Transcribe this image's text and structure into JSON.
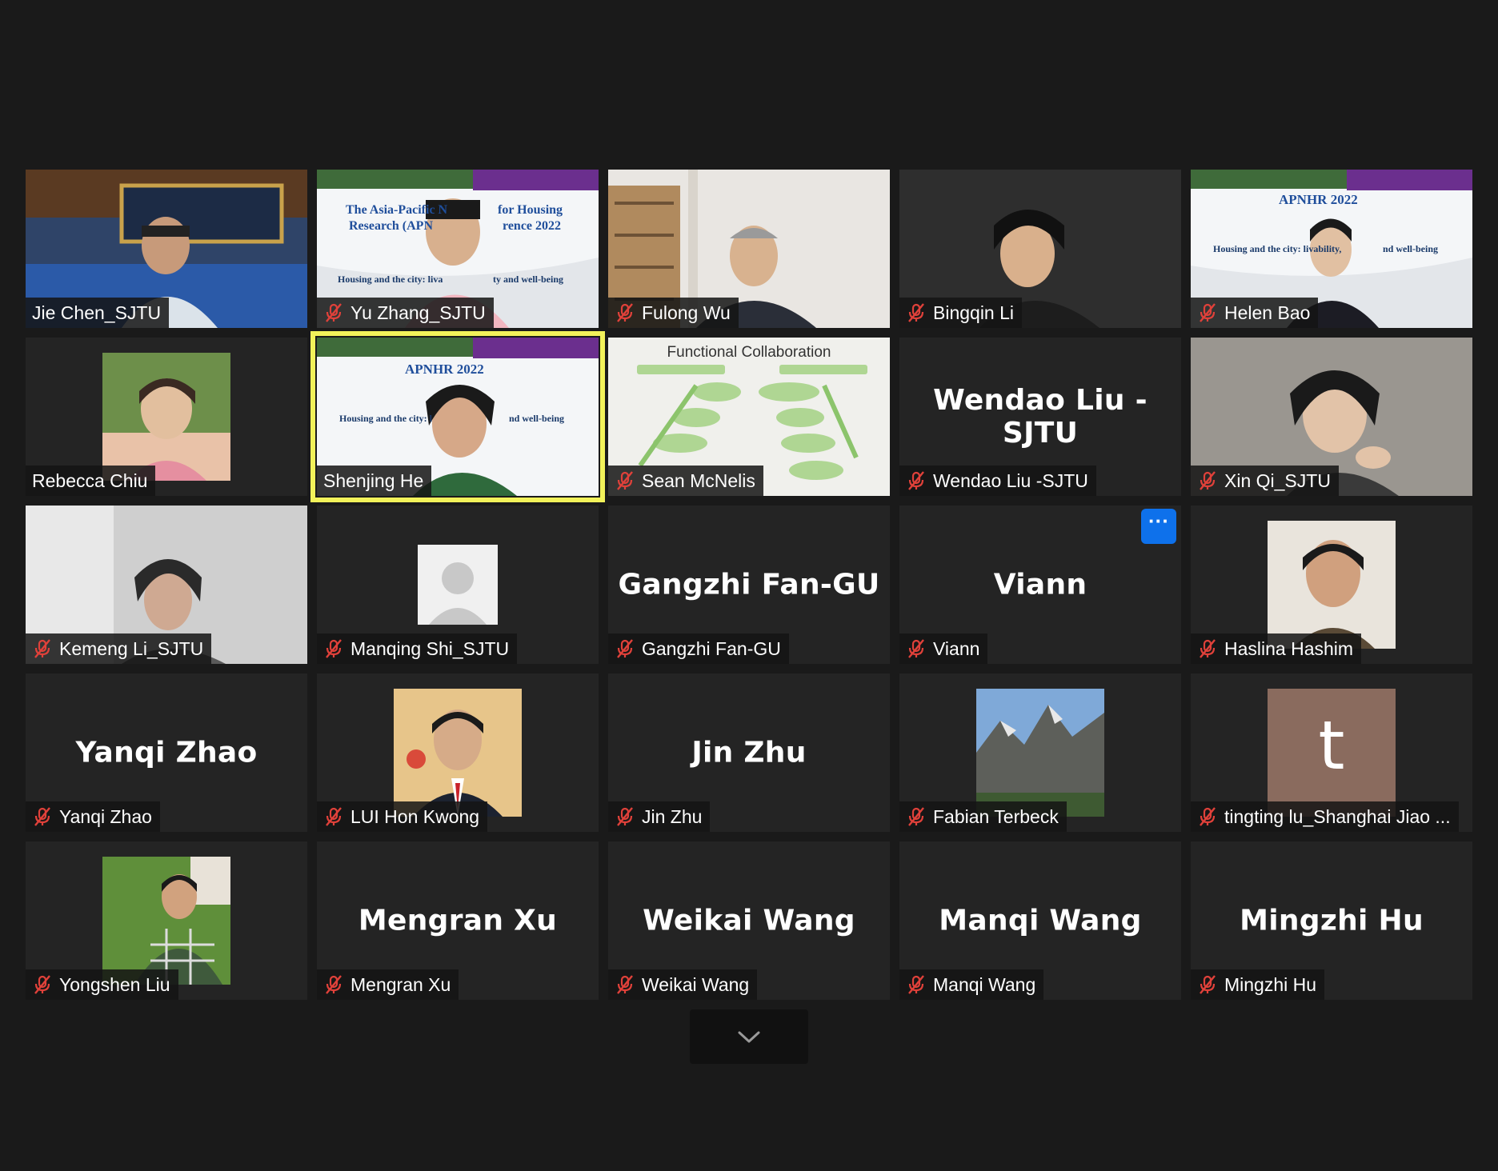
{
  "participants": [
    {
      "name": "Jie Chen_SJTU",
      "muted": false
    },
    {
      "name": "Yu Zhang_SJTU",
      "muted": true
    },
    {
      "name": "Fulong Wu",
      "muted": true
    },
    {
      "name": "Bingqin Li",
      "muted": true
    },
    {
      "name": "Helen Bao",
      "muted": true
    },
    {
      "name": "Rebecca Chiu",
      "muted": false
    },
    {
      "name": "Shenjing He",
      "muted": false
    },
    {
      "name": "Sean McNelis",
      "muted": true
    },
    {
      "name": "Wendao Liu -SJTU",
      "muted": true,
      "center_label": "Wendao Liu -SJTU"
    },
    {
      "name": "Xin Qi_SJTU",
      "muted": true
    },
    {
      "name": "Kemeng Li_SJTU",
      "muted": true
    },
    {
      "name": "Manqing Shi_SJTU",
      "muted": true
    },
    {
      "name": "Gangzhi Fan-GU",
      "muted": true,
      "center_label": "Gangzhi Fan-GU"
    },
    {
      "name": "Viann",
      "muted": true,
      "center_label": "Viann",
      "more_label": "···"
    },
    {
      "name": "Haslina Hashim",
      "muted": true
    },
    {
      "name": "Yanqi Zhao",
      "muted": true,
      "center_label": "Yanqi Zhao"
    },
    {
      "name": "LUI Hon Kwong",
      "muted": true
    },
    {
      "name": "Jin Zhu",
      "muted": true,
      "center_label": "Jin Zhu"
    },
    {
      "name": "Fabian Terbeck",
      "muted": true
    },
    {
      "name": "tingting lu_Shanghai Jiao ...",
      "muted": true,
      "avatar_letter": "t"
    },
    {
      "name": "Yongshen Liu",
      "muted": true
    },
    {
      "name": "Mengran Xu",
      "muted": true,
      "center_label": "Mengran Xu"
    },
    {
      "name": "Weikai Wang",
      "muted": true,
      "center_label": "Weikai Wang"
    },
    {
      "name": "Manqi Wang",
      "muted": true,
      "center_label": "Manqi Wang"
    },
    {
      "name": "Mingzhi Hu",
      "muted": true,
      "center_label": "Mingzhi Hu"
    }
  ],
  "slides": {
    "yu_title": "The Asia-Pacific N",
    "yu_title2": "for Housing",
    "yu_sub": "Research (APN",
    "yu_sub2": "rence 2022",
    "yu_line": "Housing and the city: liva",
    "yu_line2": "ty and well-being",
    "helen_title": "APNHR  2022",
    "helen_line": "Housing and the city: livability,",
    "helen_line2": "nd well-being",
    "he_title": "APNHR  2022",
    "he_line": "Housing and the city: l",
    "he_line2": "nd well-being",
    "sean_title": "Functional Collaboration"
  },
  "colors": {
    "background": "#1a1a1a",
    "tile": "#242424",
    "active_speaker": "#f2f25a",
    "mic_muted": "#e0413a",
    "accent": "#0e71eb"
  },
  "icons": {
    "mic": "mic-muted-icon",
    "more": "more-options-icon",
    "scroll": "chevron-down-icon"
  }
}
